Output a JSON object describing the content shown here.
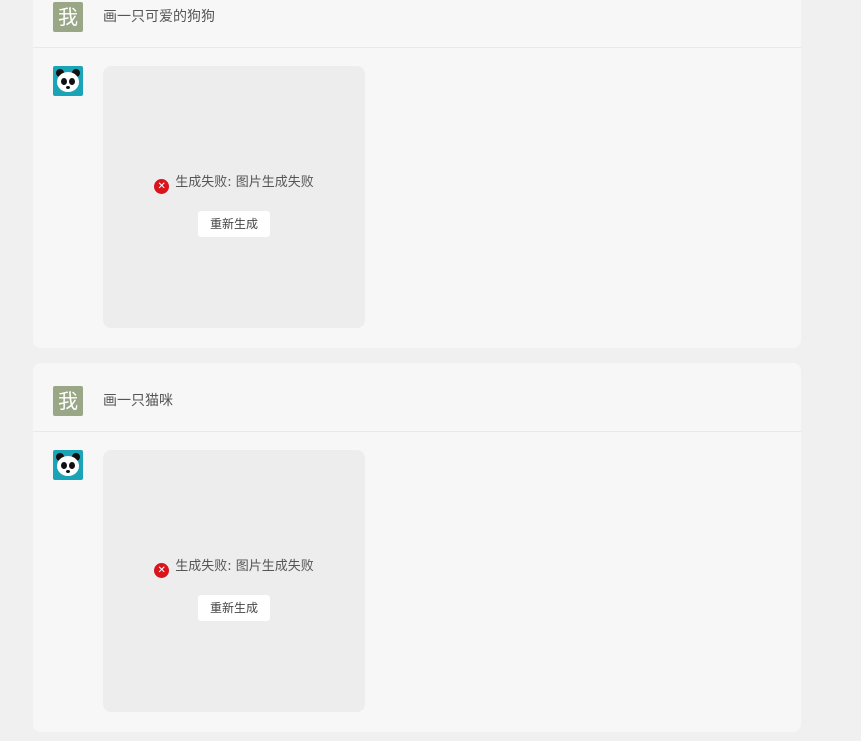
{
  "conversation": [
    {
      "user_avatar_text": "我",
      "prompt": "画一只可爱的狗狗",
      "bot_avatar_icon": "panda-icon",
      "error_icon": "error-circle-icon",
      "error_message": "生成失败: 图片生成失败",
      "retry_label": "重新生成"
    },
    {
      "user_avatar_text": "我",
      "prompt": "画一只猫咪",
      "bot_avatar_icon": "panda-icon",
      "error_icon": "error-circle-icon",
      "error_message": "生成失败: 图片生成失败",
      "retry_label": "重新生成"
    }
  ],
  "colors": {
    "page_background": "#eff0ef",
    "card_background": "#f7f7f7",
    "image_placeholder": "#ededed",
    "user_avatar": "#9aa786",
    "bot_avatar": "#1ba4b8",
    "error_red": "#d9141b"
  }
}
